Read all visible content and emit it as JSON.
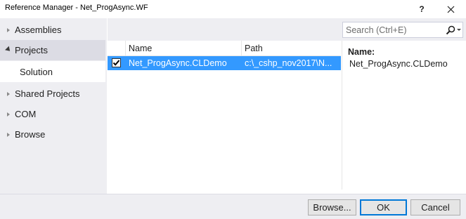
{
  "window": {
    "title": "Reference Manager - Net_ProgAsync.WF",
    "help_label": "?"
  },
  "sidebar": {
    "items": [
      {
        "label": "Assemblies"
      },
      {
        "label": "Projects"
      },
      {
        "label": "Solution"
      },
      {
        "label": "Shared Projects"
      },
      {
        "label": "COM"
      },
      {
        "label": "Browse"
      }
    ]
  },
  "search": {
    "placeholder": "Search (Ctrl+E)"
  },
  "grid": {
    "columns": [
      "Name",
      "Path"
    ],
    "rows": [
      {
        "checked": true,
        "name": "Net_ProgAsync.CLDemo",
        "path": "c:\\_cshp_nov2017\\N..."
      }
    ]
  },
  "details": {
    "label": "Name:",
    "value": "Net_ProgAsync.CLDemo"
  },
  "footer": {
    "browse_label": "Browse...",
    "ok_label": "OK",
    "cancel_label": "Cancel"
  },
  "colors": {
    "selection": "#3399ff",
    "panel_bg": "#eeeef2",
    "accent": "#0078d7"
  }
}
